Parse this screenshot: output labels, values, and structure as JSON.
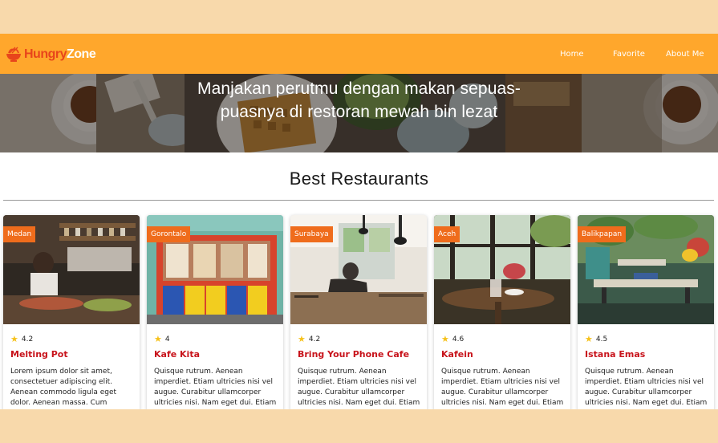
{
  "brand": {
    "part1": "Hungry",
    "part2": "Zone"
  },
  "nav": {
    "home": "Home",
    "favorite": "Favorite",
    "about": "About Me"
  },
  "hero": {
    "line1": "Manjakan perutmu dengan makan sepuas-",
    "line2": "puasnya di restoran mewah bin lezat"
  },
  "section": {
    "title": "Best Restaurants"
  },
  "colors": {
    "header": "#ffa72c",
    "badge": "#ef6c1c",
    "name": "#c8141c",
    "star": "#f6c21b",
    "page_bg": "#f8d9ab"
  },
  "restaurants": [
    {
      "city": "Medan",
      "rating": "4.2",
      "name": "Melting Pot",
      "desc": "Lorem ipsum dolor sit amet, consectetuer adipiscing elit. Aenean commodo ligula eget dolor. Aenean massa. Cum sociis..."
    },
    {
      "city": "Gorontalo",
      "rating": "4",
      "name": "Kafe Kita",
      "desc": "Quisque rutrum. Aenean imperdiet. Etiam ultricies nisi vel augue. Curabitur ullamcorper ultricies nisi. Nam eget dui. Etiam rhoncus..."
    },
    {
      "city": "Surabaya",
      "rating": "4.2",
      "name": "Bring Your Phone Cafe",
      "desc": "Quisque rutrum. Aenean imperdiet. Etiam ultricies nisi vel augue. Curabitur ullamcorper ultricies nisi. Nam eget dui. Etiam rhoncus..."
    },
    {
      "city": "Aceh",
      "rating": "4.6",
      "name": "Kafein",
      "desc": "Quisque rutrum. Aenean imperdiet. Etiam ultricies nisi vel augue. Curabitur ullamcorper ultricies nisi. Nam eget dui. Etiam rhoncus..."
    },
    {
      "city": "Balikpapan",
      "rating": "4.5",
      "name": "Istana Emas",
      "desc": "Quisque rutrum. Aenean imperdiet. Etiam ultricies nisi vel augue. Curabitur ullamcorper ultricies nisi. Nam eget dui. Etiam rhoncus..."
    }
  ]
}
